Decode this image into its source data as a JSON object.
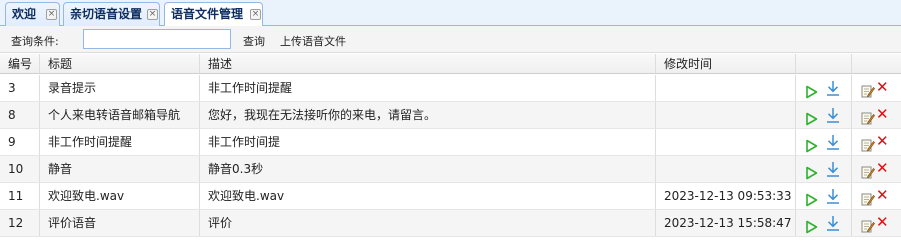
{
  "tabs": [
    {
      "label": "欢迎"
    },
    {
      "label": "亲切语音设置"
    },
    {
      "label": "语音文件管理"
    }
  ],
  "toolbar": {
    "query_label": "查询条件:",
    "query_value": "",
    "search_label": "查询",
    "upload_label": "上传语音文件"
  },
  "table": {
    "columns": [
      "编号",
      "标题",
      "描述",
      "修改时间",
      "",
      ""
    ],
    "rows": [
      {
        "id": "3",
        "title": "录音提示",
        "desc": "非工作时间提醒",
        "time": ""
      },
      {
        "id": "8",
        "title": "个人来电转语音邮箱导航",
        "desc": "您好，我现在无法接听你的来电，请留言。",
        "time": ""
      },
      {
        "id": "9",
        "title": "非工作时间提醒",
        "desc": "非工作时间提",
        "time": ""
      },
      {
        "id": "10",
        "title": "静音",
        "desc": "静音0.3秒",
        "time": ""
      },
      {
        "id": "11",
        "title": "欢迎致电.wav",
        "desc": "欢迎致电.wav",
        "time": "2023-12-13 09:53:33"
      },
      {
        "id": "12",
        "title": "评价语音",
        "desc": "评价",
        "time": "2023-12-13 15:58:47"
      }
    ]
  },
  "icons": {
    "play": "play-icon",
    "download": "download-icon",
    "edit": "edit-icon",
    "delete": "delete-icon",
    "tab_close": "close-icon"
  },
  "colors": {
    "accent": "#95b8e7",
    "play": "#2fb12f",
    "download": "#3a8fd6",
    "delete": "#d11111",
    "tab_text": "#0e2d5f"
  }
}
